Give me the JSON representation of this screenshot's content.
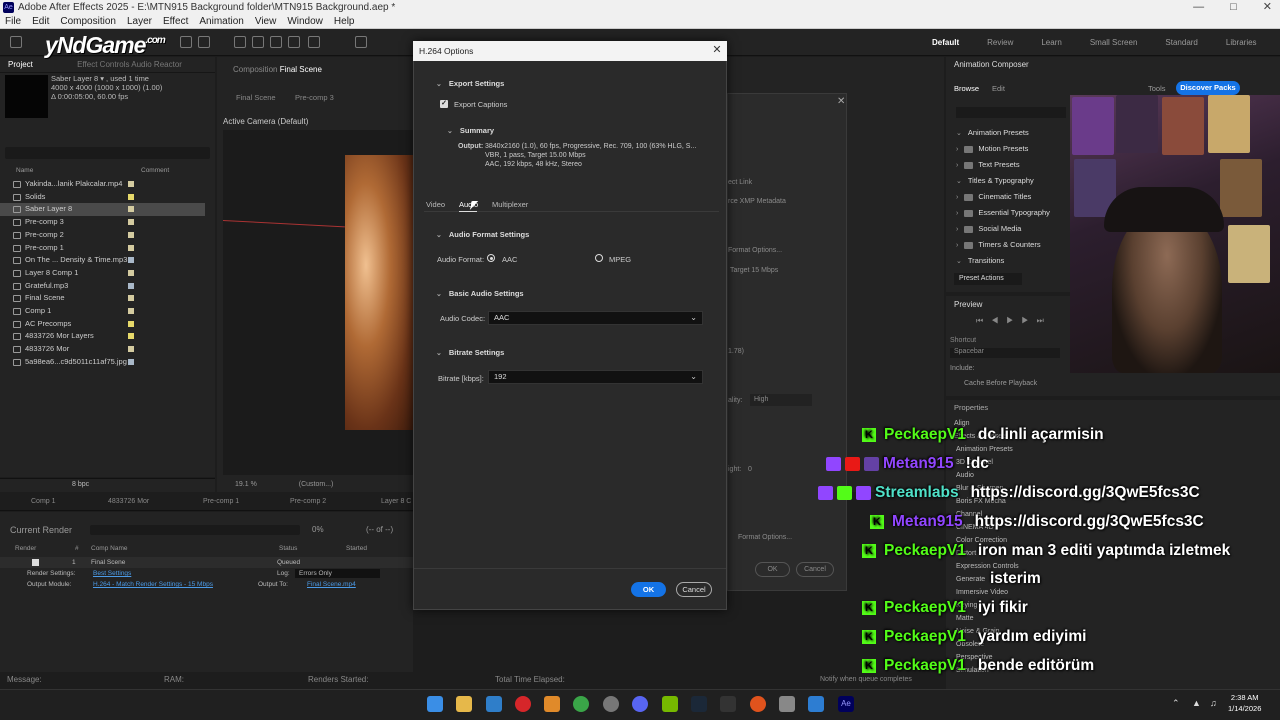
{
  "window": {
    "title": "Adobe After Effects 2025 - E:\\MTN915 Background folder\\MTN915 Background.aep *",
    "app_badge": "Ae"
  },
  "menu": [
    "File",
    "Edit",
    "Composition",
    "Layer",
    "Effect",
    "Animation",
    "View",
    "Window",
    "Help"
  ],
  "workspaces": [
    "Default",
    "Review",
    "Learn",
    "Small Screen",
    "Standard",
    "Libraries"
  ],
  "overlay_logo": {
    "text": "yNdGame",
    "suffix": ".com"
  },
  "project_panel": {
    "tab": "Project",
    "tab2": "Effect Controls Audio Reactor",
    "selected_name": "Saber Layer 8 ▾ , used 1 time",
    "selected_size": "4000 x 4000 (1000 x 1000) (1.00)",
    "selected_duration": "Δ 0:00:05:00, 60.00 fps",
    "col_name": "Name",
    "col_comment": "Comment",
    "items": [
      {
        "name": "Yakinda...lanik Plakcalar.mp4",
        "color": "#d4cba0"
      },
      {
        "name": "Solids",
        "color": "#e6d96a"
      },
      {
        "name": "Saber Layer 8",
        "color": "#d4cba0"
      },
      {
        "name": "Pre-comp 3",
        "color": "#d4cba0"
      },
      {
        "name": "Pre-comp 2",
        "color": "#d4cba0"
      },
      {
        "name": "Pre-comp 1",
        "color": "#d4cba0"
      },
      {
        "name": "On The ... Density & Time.mp3",
        "color": "#a9b8c8"
      },
      {
        "name": "Layer 8 Comp 1",
        "color": "#d4cba0"
      },
      {
        "name": "Grateful.mp3",
        "color": "#a9b8c8"
      },
      {
        "name": "Final Scene",
        "color": "#d4cba0"
      },
      {
        "name": "Comp 1",
        "color": "#d4cba0"
      },
      {
        "name": "AC Precomps",
        "color": "#e6d96a"
      },
      {
        "name": "4833726 Mor Layers",
        "color": "#e6d96a"
      },
      {
        "name": "4833726 Mor",
        "color": "#d4cba0"
      },
      {
        "name": "5a98ea6...c9d5011c11af75.jpg",
        "color": "#a9b8c8"
      }
    ],
    "bpc": "8 bpc"
  },
  "composition_panel": {
    "header": "Composition",
    "comp_name": "Final Scene",
    "tabs": [
      "Final Scene",
      "Pre-comp 3"
    ],
    "camera": "Active Camera (Default)",
    "zoom": "19.1 %",
    "view": "(Custom...)"
  },
  "timeline_tabs": [
    "Comp 1",
    "4833726 Mor",
    "Pre-comp 1",
    "Pre-comp 2",
    "Layer 8 C"
  ],
  "render_queue": {
    "title": "Current Render",
    "percent": "0%",
    "of": "(-- of --)",
    "cols": [
      "Render",
      "#",
      "Comp Name",
      "Status",
      "Started"
    ],
    "item_num": "1",
    "item_comp": "Final Scene",
    "item_status": "Queued",
    "render_settings_label": "Render Settings:",
    "render_settings_value": "Best Settings",
    "log_label": "Log:",
    "log_value": "Errors Only",
    "output_module_label": "Output Module:",
    "output_module_value": "H.264 - Match Render Settings - 15 Mbps",
    "output_to_label": "Output To:",
    "output_to_value": "Final Scene.mp4"
  },
  "status_bar": {
    "message": "Message:",
    "ram": "RAM:",
    "renders_started": "Renders Started:",
    "elapsed": "Total Time Elapsed:",
    "notify": "Notify when queue completes"
  },
  "animation_composer": {
    "title": "Animation Composer",
    "tabs": [
      "Browse",
      "Edit"
    ],
    "tools": "Tools",
    "discover": "Discover Packs",
    "tree": [
      {
        "label": "Animation Presets",
        "level": 0
      },
      {
        "label": "Motion Presets",
        "level": 1
      },
      {
        "label": "Text Presets",
        "level": 1
      },
      {
        "label": "Titles & Typography",
        "level": 0
      },
      {
        "label": "Cinematic Titles",
        "level": 1
      },
      {
        "label": "Essential Typography",
        "level": 1
      },
      {
        "label": "Social Media",
        "level": 1
      },
      {
        "label": "Timers & Counters",
        "level": 1
      },
      {
        "label": "Transitions",
        "level": 0
      }
    ],
    "preset_actions": "Preset Actions"
  },
  "preview_panel": {
    "title": "Preview",
    "shortcut_label": "Shortcut",
    "shortcut_value": "Spacebar",
    "include": "Include:",
    "cache": "Cache Before Playback"
  },
  "properties_panel": {
    "title": "Properties",
    "items": [
      "Align",
      "Effects & Presets",
      "Animation Presets",
      "3D Channel",
      "Audio",
      "Blur & Sharpen",
      "Boris FX Mocha",
      "Channel",
      "CINEMA 4D",
      "Color Correction",
      "Distort",
      "Expression Controls",
      "Generate",
      "Immersive Video",
      "Keying",
      "Matte",
      "Noise & Grain",
      "Obsolete",
      "Perspective",
      "Simulation"
    ]
  },
  "bg_dialog": {
    "texts": [
      "ect Link",
      "rce XMP Metadata",
      "Format Options...",
      "Target 15 Mbps",
      "1.78)",
      "ality:",
      "High",
      "ight:",
      "0",
      "Format Options...",
      "OK",
      "Cancel"
    ]
  },
  "h264_dialog": {
    "title": "H.264 Options",
    "export_settings": "Export Settings",
    "export_captions": "Export Captions",
    "summary": "Summary",
    "output_label": "Output:",
    "output_line1": "3840x2160 (1.0), 60 fps, Progressive, Rec. 709, 100 (63% HLG, S...",
    "output_line2": "VBR, 1 pass, Target 15.00 Mbps",
    "output_line3": "AAC, 192 kbps, 48 kHz, Stereo",
    "tabs": [
      "Video",
      "Audio",
      "Multiplexer"
    ],
    "active_tab": "Audio",
    "audio_format_settings": "Audio Format Settings",
    "audio_format_label": "Audio Format:",
    "audio_format_options": [
      "AAC",
      "MPEG"
    ],
    "audio_format_selected": "AAC",
    "basic_audio_settings": "Basic Audio Settings",
    "audio_codec_label": "Audio Codec:",
    "audio_codec_value": "AAC",
    "bitrate_settings": "Bitrate Settings",
    "bitrate_label": "Bitrate [kbps]:",
    "bitrate_value": "192",
    "ok": "OK",
    "cancel": "Cancel"
  },
  "chat": [
    {
      "user": "PeckaepV1",
      "msg": "dc linli açarmisin",
      "user_color": "green"
    },
    {
      "user": "Metan915",
      "msg": "!dc",
      "user_color": "purple"
    },
    {
      "user": "Streamlabs",
      "msg": "https://discord.gg/3QwE5fcs3C",
      "user_color": "teal"
    },
    {
      "user": "Metan915",
      "msg": "https://discord.gg/3QwE5fcs3C",
      "user_color": "purple"
    },
    {
      "user": "PeckaepV1",
      "msg": "iron man 3 editi yaptımda izletmek",
      "user_color": "green"
    },
    {
      "user": "",
      "msg": "isterim",
      "user_color": "green"
    },
    {
      "user": "PeckaepV1",
      "msg": "iyi fikir",
      "user_color": "green"
    },
    {
      "user": "PeckaepV1",
      "msg": "yardım ediyimi",
      "user_color": "green"
    },
    {
      "user": "PeckaepV1",
      "msg": "bende editörüm",
      "user_color": "green"
    }
  ],
  "taskbar": {
    "time": "2:38 AM",
    "date": "1/14/2026"
  }
}
